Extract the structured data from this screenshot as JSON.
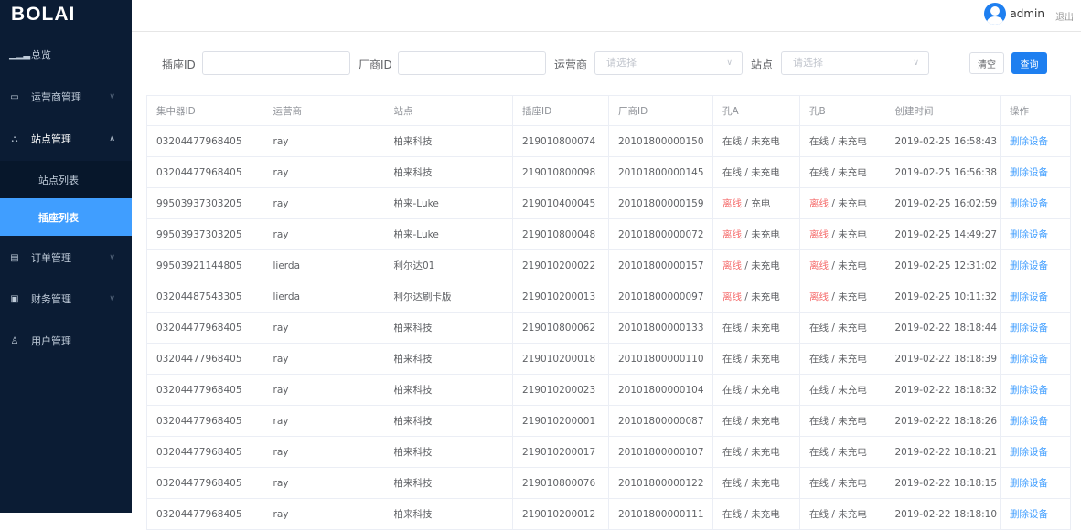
{
  "app": {
    "logo": "BOLAI"
  },
  "sidebar": {
    "items": [
      {
        "label": "总览",
        "icon": "bar-chart-icon"
      },
      {
        "label": "运营商管理",
        "icon": "id-card-icon"
      },
      {
        "label": "站点管理",
        "icon": "sitemap-icon"
      },
      {
        "label": "订单管理",
        "icon": "document-icon"
      },
      {
        "label": "财务管理",
        "icon": "wallet-icon"
      },
      {
        "label": "用户管理",
        "icon": "user-icon"
      }
    ],
    "subitems": [
      {
        "label": "站点列表"
      },
      {
        "label": "插座列表"
      }
    ]
  },
  "header": {
    "user": "admin",
    "logout": "退出"
  },
  "filters": {
    "socket_id_label": "插座ID",
    "vendor_id_label": "厂商ID",
    "operator_label": "运营商",
    "operator_placeholder": "请选择",
    "station_label": "站点",
    "station_placeholder": "请选择",
    "clear": "清空",
    "query": "查询"
  },
  "colors": {
    "accent": "#409eff",
    "offline": "#f56c6c",
    "sidebar": "#0b1c34"
  },
  "table": {
    "columns": [
      "集中器ID",
      "运营商",
      "站点",
      "插座ID",
      "厂商ID",
      "孔A",
      "孔B",
      "创建时间",
      "操作"
    ],
    "rows": [
      [
        "03204477968405",
        "ray",
        "柏来科技",
        "219010800074",
        "20101800000150",
        "在线",
        "未充电",
        "在线",
        "未充电",
        "2019-02-25 16:58:43",
        "删除设备"
      ],
      [
        "03204477968405",
        "ray",
        "柏来科技",
        "219010800098",
        "20101800000145",
        "在线",
        "未充电",
        "在线",
        "未充电",
        "2019-02-25 16:56:38",
        "删除设备"
      ],
      [
        "99503937303205",
        "ray",
        "柏来-Luke",
        "219010400045",
        "20101800000159",
        "离线",
        "充电",
        "离线",
        "未充电",
        "2019-02-25 16:02:59",
        "删除设备"
      ],
      [
        "99503937303205",
        "ray",
        "柏来-Luke",
        "219010800048",
        "20101800000072",
        "离线",
        "未充电",
        "离线",
        "未充电",
        "2019-02-25 14:49:27",
        "删除设备"
      ],
      [
        "99503921144805",
        "lierda",
        "利尔达01",
        "219010200022",
        "20101800000157",
        "离线",
        "未充电",
        "离线",
        "未充电",
        "2019-02-25 12:31:02",
        "删除设备"
      ],
      [
        "03204487543305",
        "lierda",
        "利尔达刷卡版",
        "219010200013",
        "20101800000097",
        "离线",
        "未充电",
        "离线",
        "未充电",
        "2019-02-25 10:11:32",
        "删除设备"
      ],
      [
        "03204477968405",
        "ray",
        "柏来科技",
        "219010800062",
        "20101800000133",
        "在线",
        "未充电",
        "在线",
        "未充电",
        "2019-02-22 18:18:44",
        "删除设备"
      ],
      [
        "03204477968405",
        "ray",
        "柏来科技",
        "219010200018",
        "20101800000110",
        "在线",
        "未充电",
        "在线",
        "未充电",
        "2019-02-22 18:18:39",
        "删除设备"
      ],
      [
        "03204477968405",
        "ray",
        "柏来科技",
        "219010200023",
        "20101800000104",
        "在线",
        "未充电",
        "在线",
        "未充电",
        "2019-02-22 18:18:32",
        "删除设备"
      ],
      [
        "03204477968405",
        "ray",
        "柏来科技",
        "219010200001",
        "20101800000087",
        "在线",
        "未充电",
        "在线",
        "未充电",
        "2019-02-22 18:18:26",
        "删除设备"
      ],
      [
        "03204477968405",
        "ray",
        "柏来科技",
        "219010200017",
        "20101800000107",
        "在线",
        "未充电",
        "在线",
        "未充电",
        "2019-02-22 18:18:21",
        "删除设备"
      ],
      [
        "03204477968405",
        "ray",
        "柏来科技",
        "219010800076",
        "20101800000122",
        "在线",
        "未充电",
        "在线",
        "未充电",
        "2019-02-22 18:18:15",
        "删除设备"
      ],
      [
        "03204477968405",
        "ray",
        "柏来科技",
        "219010200012",
        "20101800000111",
        "在线",
        "未充电",
        "在线",
        "未充电",
        "2019-02-22 18:18:10",
        "删除设备"
      ]
    ]
  }
}
